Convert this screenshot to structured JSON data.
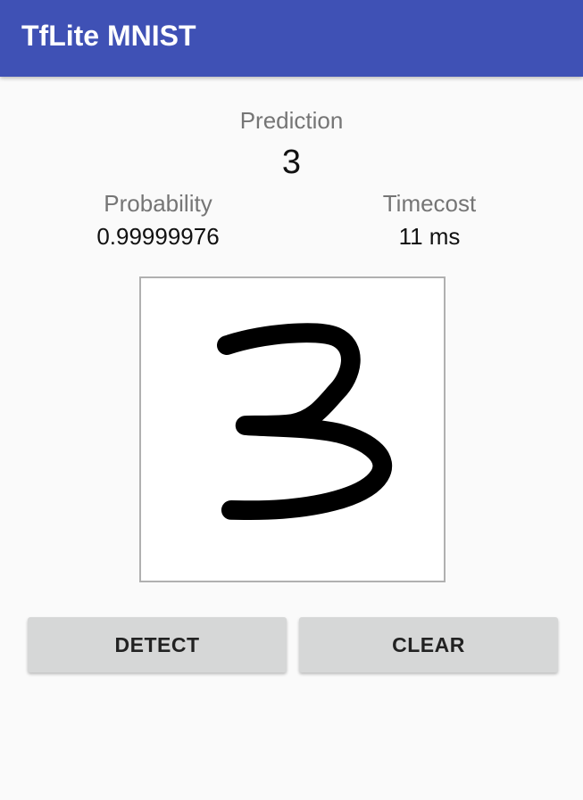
{
  "app_bar": {
    "title": "TfLite MNIST",
    "color": "#3f51b5"
  },
  "result": {
    "prediction_label": "Prediction",
    "prediction_value": "3",
    "probability_label": "Probability",
    "probability_value": "0.99999976",
    "timecost_label": "Timecost",
    "timecost_value": "11 ms"
  },
  "canvas": {
    "drawn_digit": "3",
    "stroke_color": "#000000"
  },
  "buttons": {
    "detect_label": "DETECT",
    "clear_label": "CLEAR"
  }
}
